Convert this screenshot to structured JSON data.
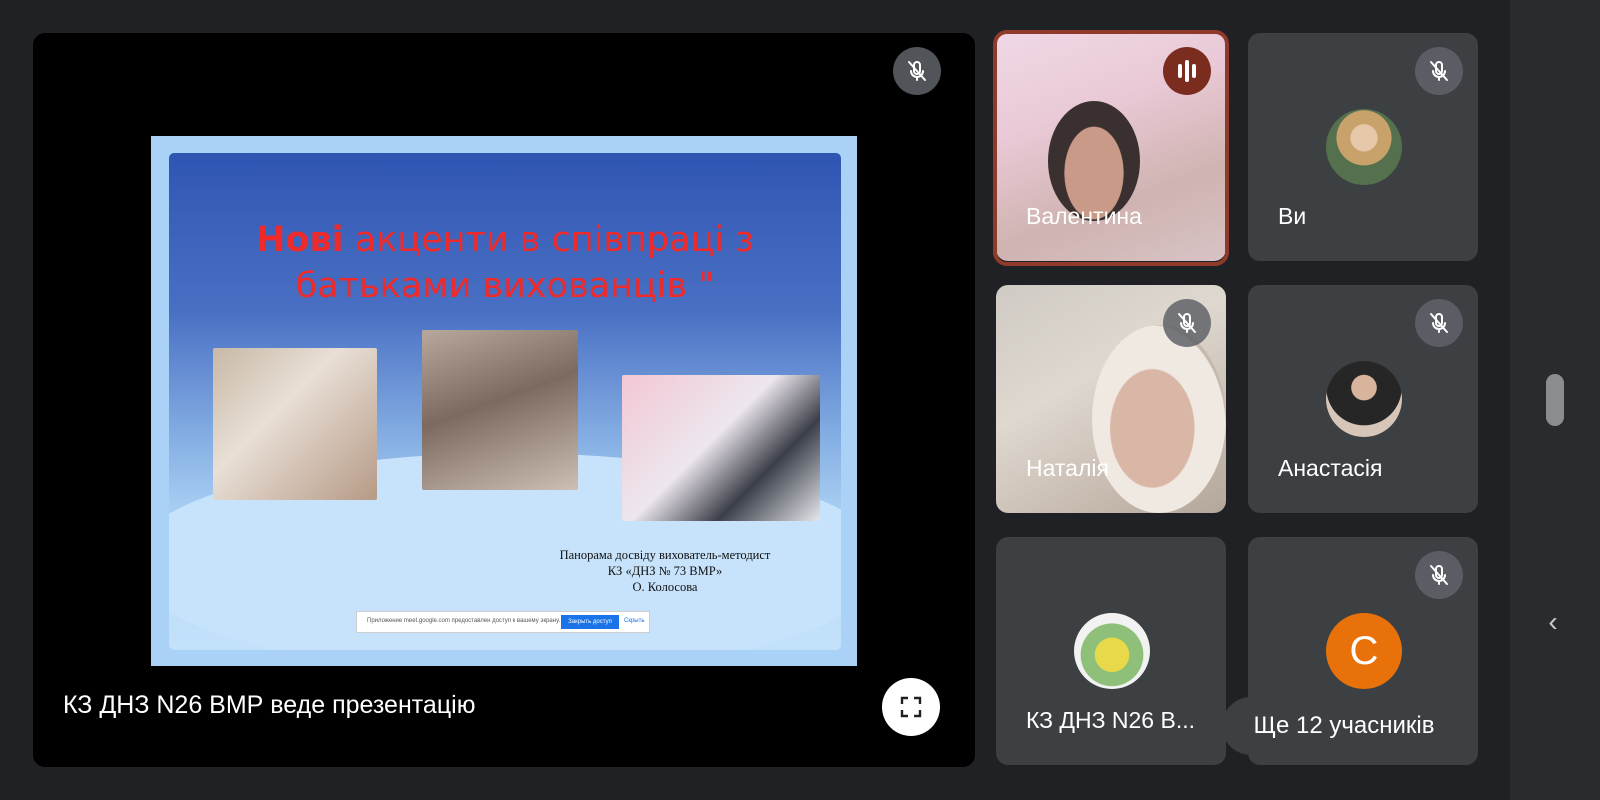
{
  "presentation": {
    "presenter_label": "КЗ ДНЗ N26 ВМР веде презентацію",
    "slide": {
      "title_bold": "Нові",
      "title_rest": " акценти в співпраці з батьками вихованців \"",
      "caption_line1": "Панорама досвіду  вихователь-методист",
      "caption_line2": "КЗ «ДНЗ № 73 ВМР»",
      "caption_line3": "О.  Колосова",
      "share_bar_text": "Приложение meet.google.com предоставлен доступ к вашему экрану.",
      "share_bar_stop": "Закрыть доступ",
      "share_bar_hide": "Скрыть"
    }
  },
  "participants": [
    {
      "name": "Валентина",
      "status": "speaking"
    },
    {
      "name": "Ви",
      "status": "muted"
    },
    {
      "name": "Наталія",
      "status": "muted"
    },
    {
      "name": "Анастасія",
      "status": "muted"
    },
    {
      "name": "КЗ ДНЗ N26 В...",
      "status": "unmuted"
    },
    {
      "name": "",
      "avatar_letter": "C",
      "status": "muted"
    }
  ],
  "more_participants_label": "Ще 12 учасників",
  "colors": {
    "background": "#202124",
    "tile": "#3c4043",
    "speaking_border": "#8f3a2a",
    "avatar_orange": "#e8710a",
    "slide_title": "#ee2a2a"
  }
}
